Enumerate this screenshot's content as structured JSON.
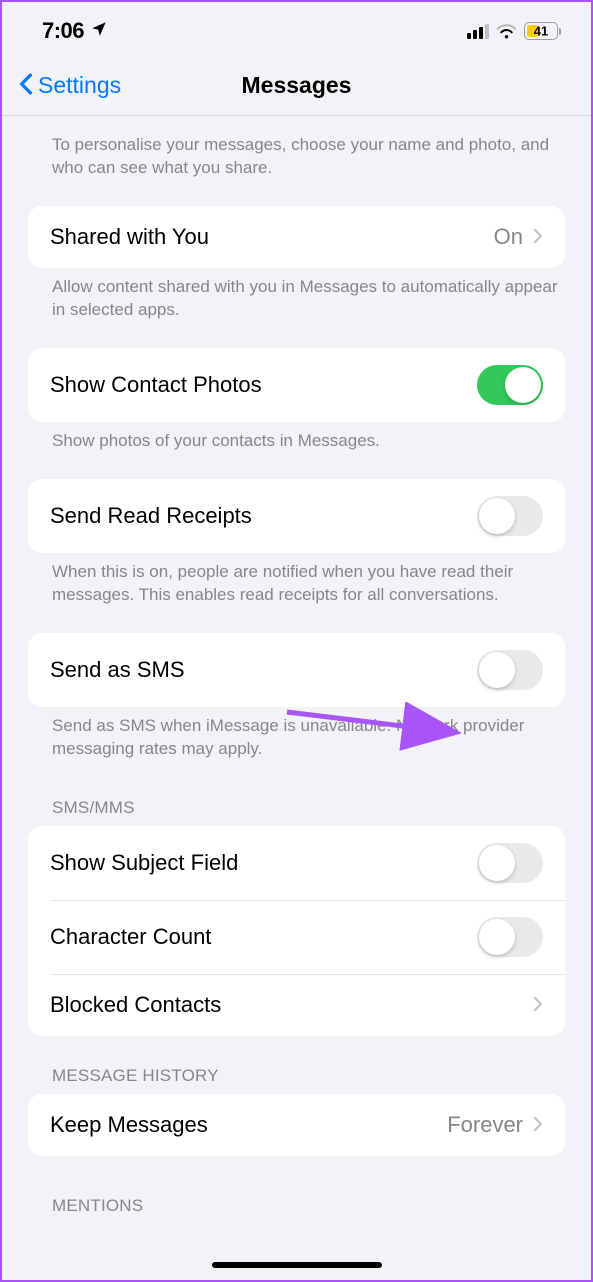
{
  "status_bar": {
    "time": "7:06",
    "battery_pct": "41"
  },
  "nav": {
    "back_label": "Settings",
    "title": "Messages"
  },
  "personalize_footer": "To personalise your messages, choose your name and photo, and who can see what you share.",
  "shared_with_you": {
    "label": "Shared with You",
    "value": "On",
    "footer": "Allow content shared with you in Messages to automatically appear in selected apps."
  },
  "show_contact_photos": {
    "label": "Show Contact Photos",
    "on": true,
    "footer": "Show photos of your contacts in Messages."
  },
  "send_read_receipts": {
    "label": "Send Read Receipts",
    "on": false,
    "footer": "When this is on, people are notified when you have read their messages. This enables read receipts for all conversations."
  },
  "send_as_sms": {
    "label": "Send as SMS",
    "on": false,
    "footer": "Send as SMS when iMessage is unavailable. Network provider messaging rates may apply."
  },
  "sms_mms": {
    "header": "SMS/MMS",
    "show_subject_field": {
      "label": "Show Subject Field",
      "on": false
    },
    "character_count": {
      "label": "Character Count",
      "on": false
    },
    "blocked_contacts": {
      "label": "Blocked Contacts"
    }
  },
  "message_history": {
    "header": "MESSAGE HISTORY",
    "keep_messages": {
      "label": "Keep Messages",
      "value": "Forever"
    }
  },
  "mentions": {
    "header": "MENTIONS"
  }
}
